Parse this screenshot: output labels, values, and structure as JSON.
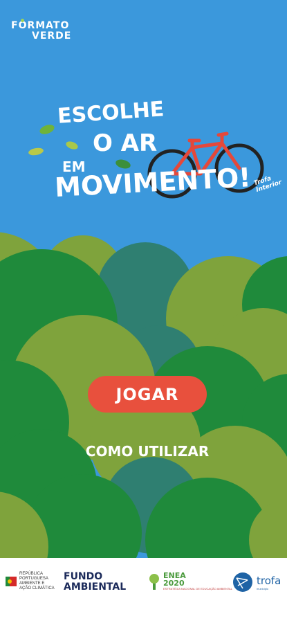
{
  "brand": {
    "line1": "FORMATO",
    "line2": "VERDE"
  },
  "logo": {
    "line1": "ESCOLHE",
    "line2": "O AR",
    "line3": "EM",
    "line4": "MOVIMENTO!",
    "location": "Trofa Interior"
  },
  "menu": {
    "play_label": "JOGAR",
    "how_to_label": "COMO UTILIZAR"
  },
  "partners": {
    "republica": {
      "line1": "REPÚBLICA",
      "line2": "PORTUGUESA",
      "line3": "AMBIENTE E",
      "line4": "AÇÃO CLIMÁTICA"
    },
    "fundo": {
      "line1": "FUNDO",
      "line2": "AMBIENTAL"
    },
    "enea": {
      "line1": "ENEA",
      "line2": "2020",
      "sub": "ESTRATÉGIA NACIONAL DE EDUCAÇÃO AMBIENTAL"
    },
    "trofa": {
      "name": "trofa",
      "sub": "município"
    }
  },
  "colors": {
    "sky": "#3b98dc",
    "accent_button": "#e8503d",
    "hill_light": "#7fa33c",
    "hill_dark": "#1f8a3b",
    "hill_teal": "#2f7f71"
  }
}
